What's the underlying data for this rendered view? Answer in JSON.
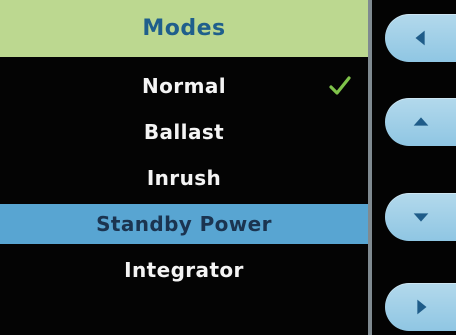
{
  "menu": {
    "title": "Modes",
    "items": [
      {
        "label": "Normal",
        "checked": true,
        "selected": false
      },
      {
        "label": "Ballast",
        "checked": false,
        "selected": false
      },
      {
        "label": "Inrush",
        "checked": false,
        "selected": false
      },
      {
        "label": "Standby Power",
        "checked": false,
        "selected": true
      },
      {
        "label": "Integrator",
        "checked": false,
        "selected": false
      }
    ]
  },
  "controls": {
    "left_icon": "chevron-left-icon",
    "up_icon": "chevron-up-icon",
    "down_icon": "chevron-down-icon",
    "right_icon": "chevron-right-icon"
  },
  "colors": {
    "header_bg": "#bcd890",
    "header_text": "#1f5f8c",
    "selected_bg": "#58a5d2",
    "check_mark": "#7fc34a",
    "button_bg": "#a9d4ea",
    "button_icon": "#1f5c89"
  }
}
